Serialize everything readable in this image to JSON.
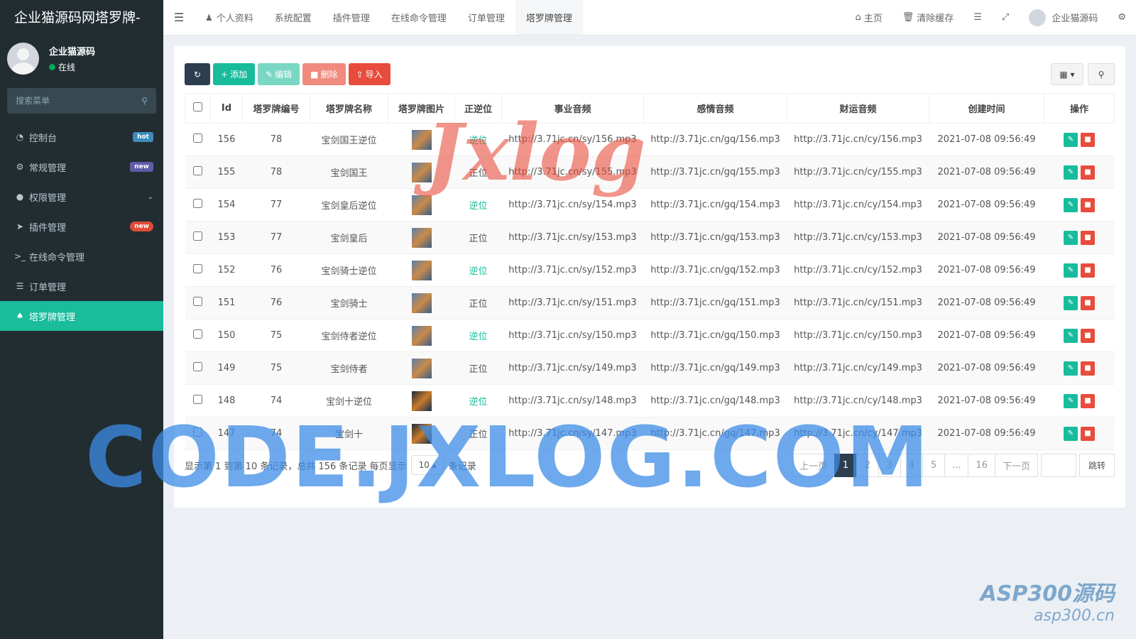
{
  "brand": "企业猫源码网塔罗牌-",
  "user": {
    "name": "企业猫源码",
    "status": "在线"
  },
  "sidebar": {
    "search_placeholder": "搜索菜单",
    "items": [
      {
        "label": "控制台",
        "icon": "dashboard-icon",
        "badge": "hot"
      },
      {
        "label": "常规管理",
        "icon": "cogs-icon",
        "badge": "new"
      },
      {
        "label": "权限管理",
        "icon": "group-icon",
        "badge": ""
      },
      {
        "label": "插件管理",
        "icon": "rocket-icon",
        "badge": "new"
      },
      {
        "label": "在线命令管理",
        "icon": "terminal-icon",
        "badge": ""
      },
      {
        "label": "订单管理",
        "icon": "list-icon",
        "badge": ""
      },
      {
        "label": "塔罗牌管理",
        "icon": "tarot-icon",
        "badge": ""
      }
    ]
  },
  "topnav": {
    "tabs": [
      "个人资料",
      "系统配置",
      "插件管理",
      "在线命令管理",
      "订单管理",
      "塔罗牌管理"
    ],
    "home": "主页",
    "clear_cache": "清除缓存",
    "account": "企业猫源码"
  },
  "toolbar": {
    "add": "添加",
    "edit": "编辑",
    "delete": "删除",
    "import": "导入"
  },
  "table": {
    "headers": [
      "Id",
      "塔罗牌编号",
      "塔罗牌名称",
      "塔罗牌图片",
      "正逆位",
      "事业音频",
      "感情音频",
      "财运音频",
      "创建时间",
      "操作"
    ],
    "rows": [
      {
        "id": "156",
        "num": "78",
        "name": "宝剑国王逆位",
        "pos": "逆位",
        "sy": "http://3.71jc.cn/sy/156.mp3",
        "gq": "http://3.71jc.cn/gq/156.mp3",
        "cy": "http://3.71jc.cn/cy/156.mp3",
        "time": "2021-07-08 09:56:49"
      },
      {
        "id": "155",
        "num": "78",
        "name": "宝剑国王",
        "pos": "正位",
        "sy": "http://3.71jc.cn/sy/155.mp3",
        "gq": "http://3.71jc.cn/gq/155.mp3",
        "cy": "http://3.71jc.cn/cy/155.mp3",
        "time": "2021-07-08 09:56:49"
      },
      {
        "id": "154",
        "num": "77",
        "name": "宝剑皇后逆位",
        "pos": "逆位",
        "sy": "http://3.71jc.cn/sy/154.mp3",
        "gq": "http://3.71jc.cn/gq/154.mp3",
        "cy": "http://3.71jc.cn/cy/154.mp3",
        "time": "2021-07-08 09:56:49"
      },
      {
        "id": "153",
        "num": "77",
        "name": "宝剑皇后",
        "pos": "正位",
        "sy": "http://3.71jc.cn/sy/153.mp3",
        "gq": "http://3.71jc.cn/gq/153.mp3",
        "cy": "http://3.71jc.cn/cy/153.mp3",
        "time": "2021-07-08 09:56:49"
      },
      {
        "id": "152",
        "num": "76",
        "name": "宝剑骑士逆位",
        "pos": "逆位",
        "sy": "http://3.71jc.cn/sy/152.mp3",
        "gq": "http://3.71jc.cn/gq/152.mp3",
        "cy": "http://3.71jc.cn/cy/152.mp3",
        "time": "2021-07-08 09:56:49"
      },
      {
        "id": "151",
        "num": "76",
        "name": "宝剑骑士",
        "pos": "正位",
        "sy": "http://3.71jc.cn/sy/151.mp3",
        "gq": "http://3.71jc.cn/gq/151.mp3",
        "cy": "http://3.71jc.cn/cy/151.mp3",
        "time": "2021-07-08 09:56:49"
      },
      {
        "id": "150",
        "num": "75",
        "name": "宝剑侍者逆位",
        "pos": "逆位",
        "sy": "http://3.71jc.cn/sy/150.mp3",
        "gq": "http://3.71jc.cn/gq/150.mp3",
        "cy": "http://3.71jc.cn/cy/150.mp3",
        "time": "2021-07-08 09:56:49"
      },
      {
        "id": "149",
        "num": "75",
        "name": "宝剑侍者",
        "pos": "正位",
        "sy": "http://3.71jc.cn/sy/149.mp3",
        "gq": "http://3.71jc.cn/gq/149.mp3",
        "cy": "http://3.71jc.cn/cy/149.mp3",
        "time": "2021-07-08 09:56:49"
      },
      {
        "id": "148",
        "num": "74",
        "name": "宝剑十逆位",
        "pos": "逆位",
        "sy": "http://3.71jc.cn/sy/148.mp3",
        "gq": "http://3.71jc.cn/gq/148.mp3",
        "cy": "http://3.71jc.cn/cy/148.mp3",
        "time": "2021-07-08 09:56:49"
      },
      {
        "id": "147",
        "num": "74",
        "name": "宝剑十",
        "pos": "正位",
        "sy": "http://3.71jc.cn/sy/147.mp3",
        "gq": "http://3.71jc.cn/gq/147.mp3",
        "cy": "http://3.71jc.cn/cy/147.mp3",
        "time": "2021-07-08 09:56:49"
      }
    ]
  },
  "footer": {
    "info": "显示第 1 到第 10 条记录，总共 156 条记录 每页显示",
    "page_size": "10",
    "suffix": "条记录",
    "pager": [
      "上一页",
      "1",
      "2",
      "3",
      "4",
      "5",
      "...",
      "16",
      "下一页"
    ],
    "jump": "跳转"
  },
  "watermarks": {
    "jxlog": "Jxlog",
    "code": "CODE.JXLOG.COM",
    "asp1": "ASP300源码",
    "asp2": "asp300.cn"
  },
  "colors": {
    "sidebar_bg": "#222d32",
    "accent": "#18bc9c",
    "danger": "#e74c3c",
    "primary_dark": "#2c3e50"
  }
}
